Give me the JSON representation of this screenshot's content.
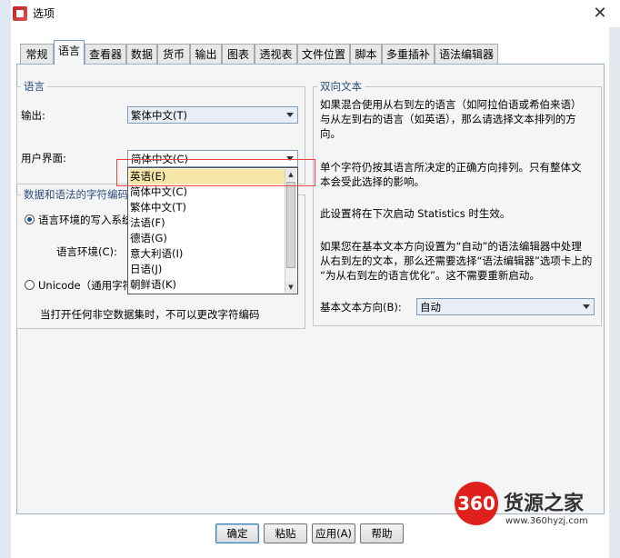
{
  "window": {
    "title": "选项",
    "close_icon": "close-icon"
  },
  "tabs": [
    {
      "label": "常规",
      "active": false
    },
    {
      "label": "语言",
      "active": true
    },
    {
      "label": "查看器",
      "active": false
    },
    {
      "label": "数据",
      "active": false
    },
    {
      "label": "货币",
      "active": false
    },
    {
      "label": "输出",
      "active": false
    },
    {
      "label": "图表",
      "active": false
    },
    {
      "label": "透视表",
      "active": false
    },
    {
      "label": "文件位置",
      "active": false
    },
    {
      "label": "脚本",
      "active": false
    },
    {
      "label": "多重插补",
      "active": false
    },
    {
      "label": "语法编辑器",
      "active": false
    }
  ],
  "language_group": {
    "legend": "语言",
    "output_label": "输出:",
    "output_value": "繁体中文(T)",
    "ui_label": "用户界面:",
    "ui_value": "简体中文(C)"
  },
  "encoding_group": {
    "legend": "数据和语法的字符编码",
    "radio_locale": "语言环境的写入系统",
    "locale_label": "语言环境(C):",
    "radio_unicode": "Unicode（通用字符",
    "note": "当打开任何非空数据集时，不可以更改字符编码"
  },
  "dropdown_options": [
    {
      "label": "英语(E)",
      "selected": true
    },
    {
      "label": "简体中文(C)",
      "selected": false
    },
    {
      "label": "繁体中文(T)",
      "selected": false
    },
    {
      "label": "法语(F)",
      "selected": false
    },
    {
      "label": "德语(G)",
      "selected": false
    },
    {
      "label": "意大利语(I)",
      "selected": false
    },
    {
      "label": "日语(J)",
      "selected": false
    },
    {
      "label": "朝鲜语(K)",
      "selected": false
    }
  ],
  "bidi_group": {
    "legend": "双向文本",
    "p1": [
      "如果混合使用从右到左的语言（如阿拉伯语或希伯来语）",
      "与从左到右的语言（如英语），那么请选择文本排列的方",
      "向。"
    ],
    "p2": [
      "单个字符仍按其语言所决定的正确方向排列。只有整体文",
      "本会受此选择的影响。"
    ],
    "p3": [
      "此设置将在下次启动 Statistics 时生效。"
    ],
    "p4": [
      "如果您在基本文本方向设置为“自动”的语法编辑器中处理",
      "从右到左的文本，那么还需要选择“语法编辑器”选项卡上的",
      "“为从右到左的语言优化”。这不需要重新启动。"
    ],
    "dir_label": "基本文本方向(B):",
    "dir_value": "自动"
  },
  "buttons": {
    "ok": "确定",
    "paste": "粘贴",
    "apply": "应用(A)",
    "help": "帮助"
  },
  "watermark": {
    "badge": "360",
    "name": "货源之家",
    "url": "www.360hyzj.com"
  },
  "colors": {
    "highlight_border": "#e44444",
    "selected_option": "#f7e7a9",
    "logo_red": "#e0201a"
  }
}
